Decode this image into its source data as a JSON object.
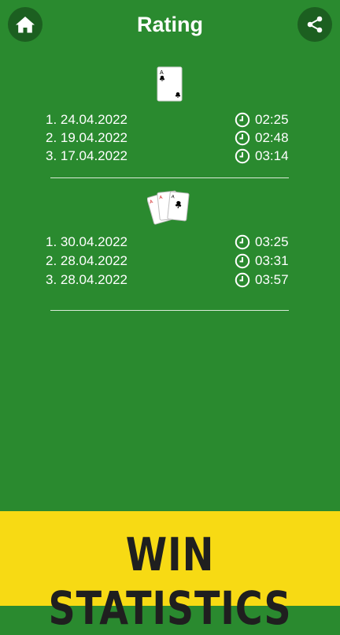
{
  "header": {
    "title": "Rating",
    "home_icon": "home-icon",
    "share_icon": "share-icon"
  },
  "colors": {
    "background": "#2a8a2f",
    "button": "#1c5f20",
    "banner": "#f7da14"
  },
  "sections": [
    {
      "icon": "single-card-icon",
      "rows": [
        {
          "rank_date": "1. 24.04.2022",
          "time": "02:25"
        },
        {
          "rank_date": "2. 19.04.2022",
          "time": "02:48"
        },
        {
          "rank_date": "3. 17.04.2022",
          "time": "03:14"
        }
      ]
    },
    {
      "icon": "three-cards-icon",
      "rows": [
        {
          "rank_date": "1. 30.04.2022",
          "time": "03:25"
        },
        {
          "rank_date": "2. 28.04.2022",
          "time": "03:31"
        },
        {
          "rank_date": "3. 28.04.2022",
          "time": "03:57"
        }
      ]
    }
  ],
  "banner": {
    "text": "WIN STATISTICS"
  }
}
